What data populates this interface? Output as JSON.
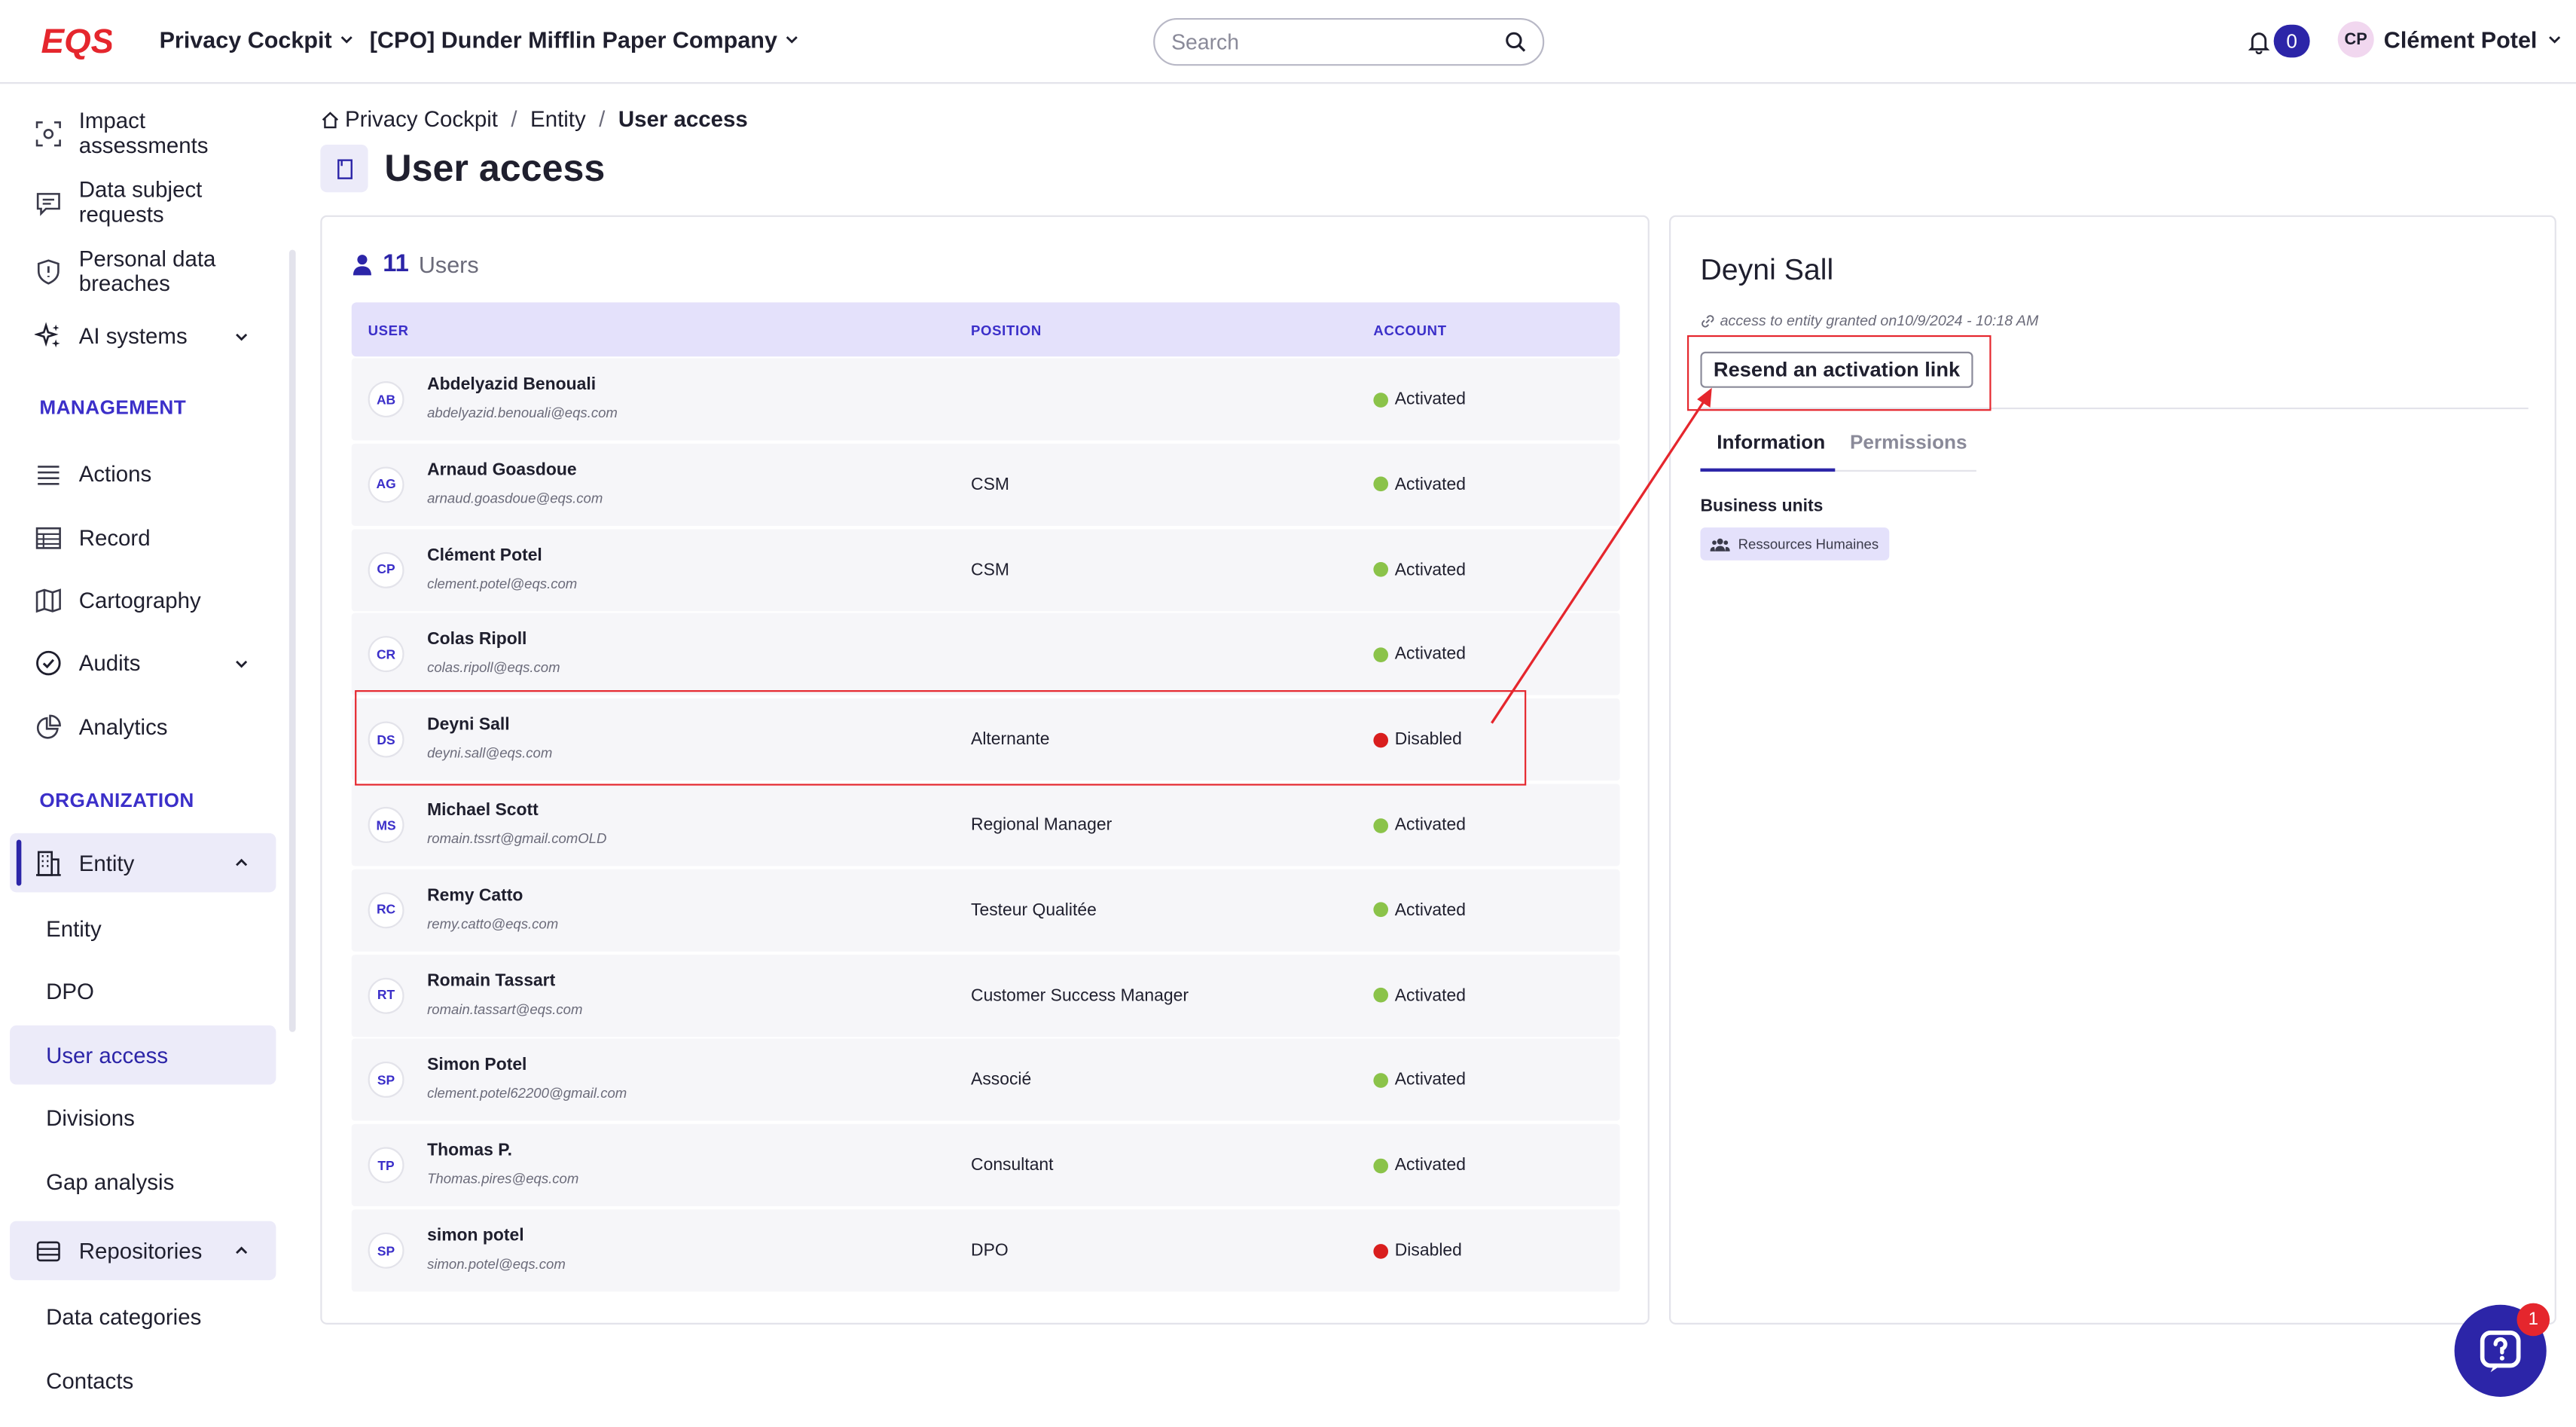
{
  "header": {
    "logo_text": "EQS",
    "app_menu": "Privacy Cockpit",
    "company_menu": "[CPO] Dunder Mifflin Paper Company",
    "search_placeholder": "Search",
    "notification_count": "0",
    "user_initials": "CP",
    "user_name": "Clément Potel"
  },
  "sidebar": {
    "items": [
      {
        "label": "Impact assessments",
        "icon": "scan-icon"
      },
      {
        "label": "Data subject requests",
        "icon": "chat-icon"
      },
      {
        "label": "Personal data breaches",
        "icon": "shield-icon"
      },
      {
        "label": "AI systems",
        "icon": "sparkles-icon"
      }
    ],
    "management_title": "MANAGEMENT",
    "management": [
      {
        "label": "Actions",
        "icon": "list-icon"
      },
      {
        "label": "Record",
        "icon": "table-icon"
      },
      {
        "label": "Cartography",
        "icon": "map-icon"
      },
      {
        "label": "Audits",
        "icon": "check-circle-icon"
      },
      {
        "label": "Analytics",
        "icon": "pie-chart-icon"
      }
    ],
    "organization_title": "ORGANIZATION",
    "entity_group": "Entity",
    "entity_sub": [
      "Entity",
      "DPO",
      "User access",
      "Divisions",
      "Gap analysis"
    ],
    "repositories_group": "Repositories",
    "repositories_sub": [
      "Data categories",
      "Contacts"
    ]
  },
  "breadcrumb": {
    "home": "Privacy Cockpit",
    "entity": "Entity",
    "current": "User access"
  },
  "page_title": "User access",
  "users": {
    "count": "11",
    "count_label": "Users",
    "columns": {
      "user": "USER",
      "position": "POSITION",
      "account": "ACCOUNT"
    },
    "rows": [
      {
        "initials": "AB",
        "name": "Abdelyazid Benouali",
        "email": "abdelyazid.benouali@eqs.com",
        "position": "",
        "account": "Activated"
      },
      {
        "initials": "AG",
        "name": "Arnaud Goasdoue",
        "email": "arnaud.goasdoue@eqs.com",
        "position": "CSM",
        "account": "Activated"
      },
      {
        "initials": "CP",
        "name": "Clément Potel",
        "email": "clement.potel@eqs.com",
        "position": "CSM",
        "account": "Activated"
      },
      {
        "initials": "CR",
        "name": "Colas Ripoll",
        "email": "colas.ripoll@eqs.com",
        "position": "",
        "account": "Activated"
      },
      {
        "initials": "DS",
        "name": "Deyni Sall",
        "email": "deyni.sall@eqs.com",
        "position": "Alternante",
        "account": "Disabled"
      },
      {
        "initials": "MS",
        "name": "Michael Scott",
        "email": "romain.tssrt@gmail.comOLD",
        "position": "Regional Manager",
        "account": "Activated"
      },
      {
        "initials": "RC",
        "name": "Remy Catto",
        "email": "remy.catto@eqs.com",
        "position": "Testeur Qualitée",
        "account": "Activated"
      },
      {
        "initials": "RT",
        "name": "Romain Tassart",
        "email": "romain.tassart@eqs.com",
        "position": "Customer Success Manager",
        "account": "Activated"
      },
      {
        "initials": "SP",
        "name": "Simon Potel",
        "email": "clement.potel62200@gmail.com",
        "position": "Associé",
        "account": "Activated"
      },
      {
        "initials": "TP",
        "name": "Thomas P.",
        "email": "Thomas.pires@eqs.com",
        "position": "Consultant",
        "account": "Activated"
      },
      {
        "initials": "SP",
        "name": "simon potel",
        "email": "simon.potel@eqs.com",
        "position": "DPO",
        "account": "Disabled"
      }
    ]
  },
  "detail": {
    "name": "Deyni Sall",
    "granted": "access to entity granted on10/9/2024 - 10:18 AM",
    "resend_label": "Resend an activation link",
    "tabs": [
      "Information",
      "Permissions"
    ],
    "business_units_label": "Business units",
    "business_unit": "Ressources Humaines"
  },
  "help": {
    "badge": "1"
  },
  "colors": {
    "accent": "#2c25a8",
    "activated": "#8bc34a",
    "disabled": "#d91e1e",
    "annotation": "#e5262d",
    "section_title": "#3b2fc9"
  }
}
